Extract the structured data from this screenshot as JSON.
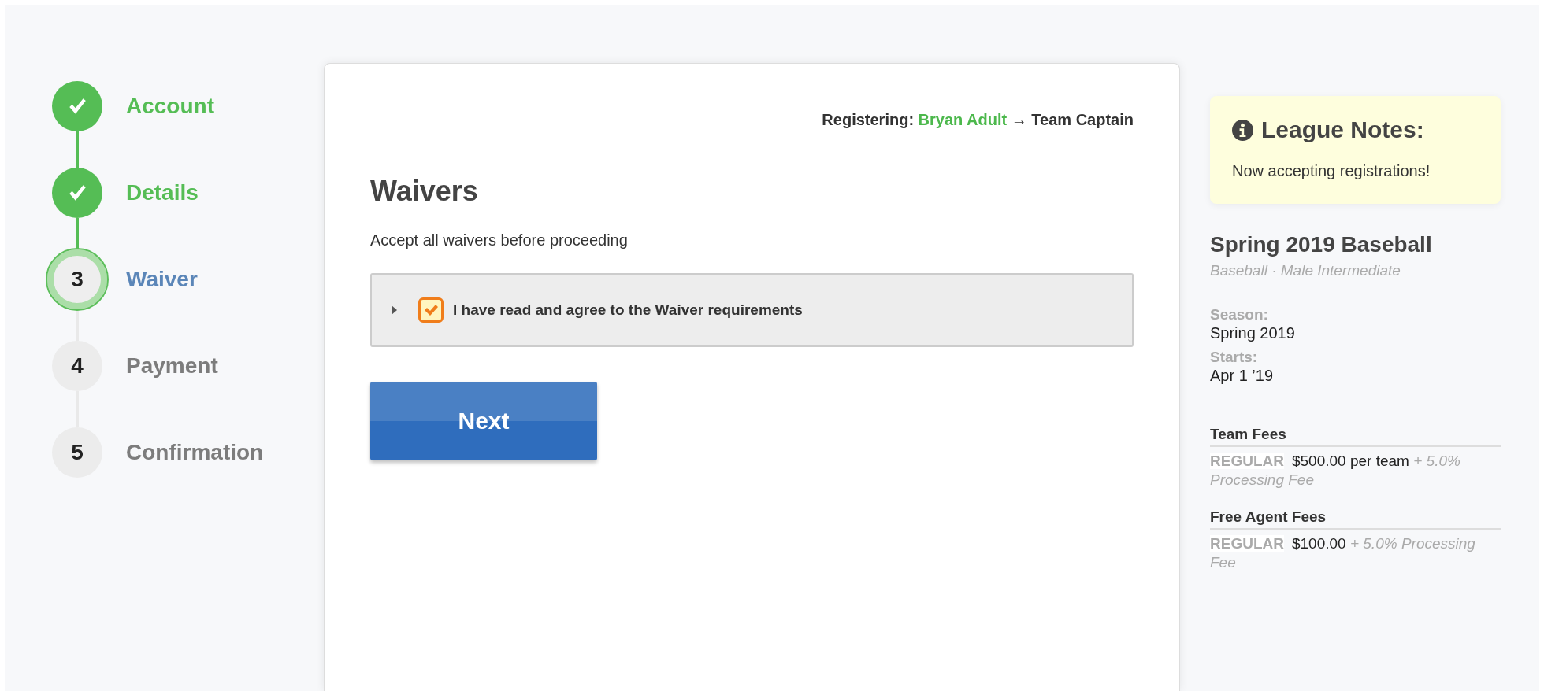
{
  "steps": [
    {
      "label": "Account",
      "completed": true,
      "selected": false
    },
    {
      "label": "Details",
      "completed": true,
      "selected": false
    },
    {
      "number": "3",
      "label": "Waiver",
      "completed": false,
      "selected": true
    },
    {
      "number": "4",
      "label": "Payment",
      "completed": false,
      "selected": false
    },
    {
      "number": "5",
      "label": "Confirmation",
      "completed": false,
      "selected": false
    }
  ],
  "registering": {
    "prefix": "Registering:",
    "name": "Bryan Adult",
    "suffix": "→ Team Captain"
  },
  "title": "Waivers",
  "instructions": "Accept all waivers before proceeding",
  "waiver": {
    "label": "I have read and agree to the Waiver requirements",
    "checked": true,
    "expanded": false
  },
  "next_button": "Next",
  "league_notes": {
    "title": "League Notes:",
    "text": "Now accepting registrations!"
  },
  "league": {
    "name": "Spring 2019 Baseball",
    "subtitle": "Baseball · Male Intermediate",
    "details": [
      {
        "label": "Season:",
        "value": "Spring 2019"
      },
      {
        "label": "Starts:",
        "value": "Apr 1 ’19"
      }
    ],
    "fee_groups": [
      {
        "title": "Team Fees",
        "fees": [
          {
            "tier": "REGULAR",
            "amount": "$500.00 per team",
            "note": "+ 5.0% Processing Fee"
          }
        ]
      },
      {
        "title": "Free Agent Fees",
        "fees": [
          {
            "tier": "REGULAR",
            "amount": "$100.00",
            "note": "+ 5.0% Processing Fee"
          }
        ]
      }
    ]
  }
}
